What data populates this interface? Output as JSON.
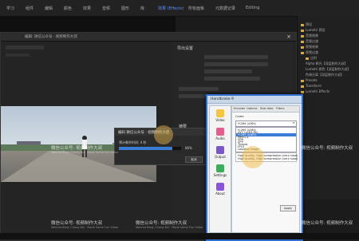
{
  "menubar": {
    "items": [
      {
        "label": "学习"
      },
      {
        "label": "组件"
      },
      {
        "label": "编辑"
      },
      {
        "label": "颜色"
      },
      {
        "label": "效果"
      },
      {
        "label": "音频"
      },
      {
        "label": "图形"
      },
      {
        "label": "库"
      },
      {
        "label": "效果 (Effects)"
      },
      {
        "label": "所有面板"
      },
      {
        "label": "元数据记录"
      },
      {
        "label": "Editing"
      }
    ],
    "active_index": 8
  },
  "export": {
    "file_field": "编辑: 微信公众号 · 视频制作大叔",
    "export_settings_label": "导出设置",
    "summary_label": "摘要",
    "summary_line": "编码 : H.264, 30fps, Youtube",
    "queue_button": "队列",
    "export_button": "导出",
    "cancel_button": "取消"
  },
  "progress_dialog": {
    "title": "编码 微信公众号 · 视频制作大叔",
    "line": "预计剩余时间: 4 秒",
    "percent": "86%",
    "value": 0.86,
    "cancel_label": "取消"
  },
  "right_panel": {
    "items": [
      "预设",
      "Lumetri 预设",
      "音频效果",
      "音频过渡",
      "视频效果",
      "视频过渡",
      "过时",
      "Alpha 辉光【深层制作大叔】",
      "Lumetri 颜色【深层制作大叔】",
      "色调分离【深层制作大叔】",
      "Presets",
      "Transform",
      "Lumetri Effects"
    ]
  },
  "handbrake": {
    "title": "Handbrake 9",
    "sidebar": [
      {
        "label": "Video"
      },
      {
        "label": "Audio"
      },
      {
        "label": "Output"
      },
      {
        "label": "Settings"
      },
      {
        "label": "About"
      }
    ],
    "tabs": [
      {
        "label": "Encoder"
      },
      {
        "label": "Options"
      },
      {
        "label": "Side data"
      },
      {
        "label": "Filters"
      }
    ],
    "codec_label": "Codec",
    "codec_selected": "H.264 (x264)",
    "codec_options": [
      "H.264 (x264)",
      "AVC (x264-ffv)",
      "H.265 (x265)",
      "MPEG-4",
      "VP8",
      "VP9",
      "Theora",
      "FFV1",
      "Lossless Image",
      "High quality, High compression (very slow)",
      "High quality, High compression (very slow)"
    ],
    "selected_index": 2,
    "apply_label": "Apply",
    "ok_label": "OK",
    "cancel_label": "Cancel"
  },
  "watermarks": {
    "main": "微信公众号: 视频制作大叔",
    "sub": "Wechat Blog: Chang Kai · Made Some Fun Video"
  },
  "colors": {
    "accent": "#3a7bd5",
    "active_menu": "#5b8ff9",
    "cursor_highlight": "#f0be50"
  }
}
